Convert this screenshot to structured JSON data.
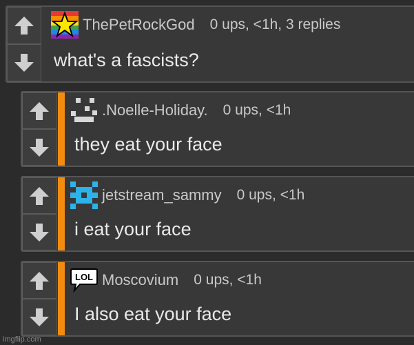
{
  "comments": [
    {
      "username": "ThePetRockGod",
      "meta": "0 ups, <1h, 3 replies",
      "text": "what's a fascists?",
      "avatar": "rainbow-star-avatar"
    },
    {
      "username": ".Noelle-Holiday.",
      "meta": "0 ups, <1h",
      "text": "they eat your face",
      "avatar": "pixel-face-avatar"
    },
    {
      "username": "jetstream_sammy",
      "meta": "0 ups, <1h",
      "text": "i eat your face",
      "avatar": "pixel-snowflake-avatar"
    },
    {
      "username": "Moscovium",
      "meta": "0 ups, <1h",
      "text": "I also eat your face",
      "avatar": "lol-speech-bubble-avatar",
      "avatar_text": "LOL"
    }
  ],
  "icons": {
    "upvote": "up-arrow-icon",
    "downvote": "down-arrow-icon"
  },
  "colors": {
    "accent": "#f28c0f",
    "background": "#2b2b2b",
    "panel": "#383838",
    "arrow": "#cfcfcf"
  },
  "watermark": "imgflip.com"
}
